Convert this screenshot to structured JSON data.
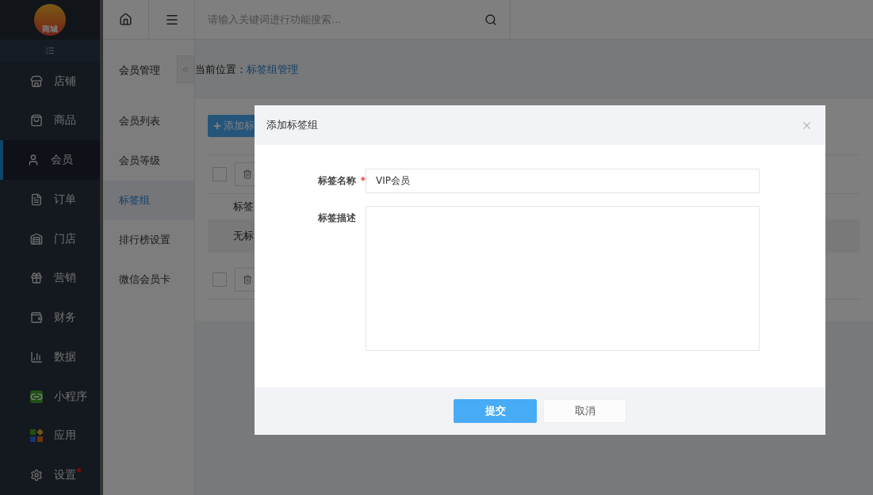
{
  "sidebar": {
    "items": [
      {
        "label": "店铺",
        "selected": false,
        "dot": false
      },
      {
        "label": "商品",
        "selected": false,
        "dot": false
      },
      {
        "label": "会员",
        "selected": true,
        "dot": false
      },
      {
        "label": "订单",
        "selected": false,
        "dot": false
      },
      {
        "label": "门店",
        "selected": false,
        "dot": false
      },
      {
        "label": "营销",
        "selected": false,
        "dot": false
      },
      {
        "label": "财务",
        "selected": false,
        "dot": false
      },
      {
        "label": "数据",
        "selected": false,
        "dot": false
      },
      {
        "label": "小程序",
        "selected": false,
        "dot": false
      },
      {
        "label": "应用",
        "selected": false,
        "dot": false
      },
      {
        "label": "设置",
        "selected": false,
        "dot": true
      }
    ]
  },
  "logo": {
    "text": "商城"
  },
  "submenu": {
    "title": "会员管理",
    "items": [
      {
        "label": "会员列表",
        "selected": false
      },
      {
        "label": "会员等级",
        "selected": false
      },
      {
        "label": "标签组",
        "selected": true
      },
      {
        "label": "排行榜设置",
        "selected": false
      },
      {
        "label": "微信会员卡",
        "selected": false
      }
    ]
  },
  "search": {
    "placeholder": "请输入关键词进行功能搜索..."
  },
  "breadcrumb": {
    "label": "当前位置：",
    "link": "标签组管理"
  },
  "content": {
    "add_button": "添加标",
    "header_cell": "标签",
    "row_cell": "无标",
    "checkboxes": [
      {
        "checked": false
      },
      {
        "checked": false
      }
    ]
  },
  "modal": {
    "title": "添加标签组",
    "fields": [
      {
        "kind": "input",
        "label": "标签名称",
        "required_mark": "*",
        "value": "VIP会员"
      },
      {
        "kind": "textarea",
        "label": "标签描述"
      }
    ],
    "buttons": [
      {
        "kind": "primary",
        "label": "提交"
      },
      {
        "kind": "default",
        "label": "取消"
      }
    ]
  }
}
